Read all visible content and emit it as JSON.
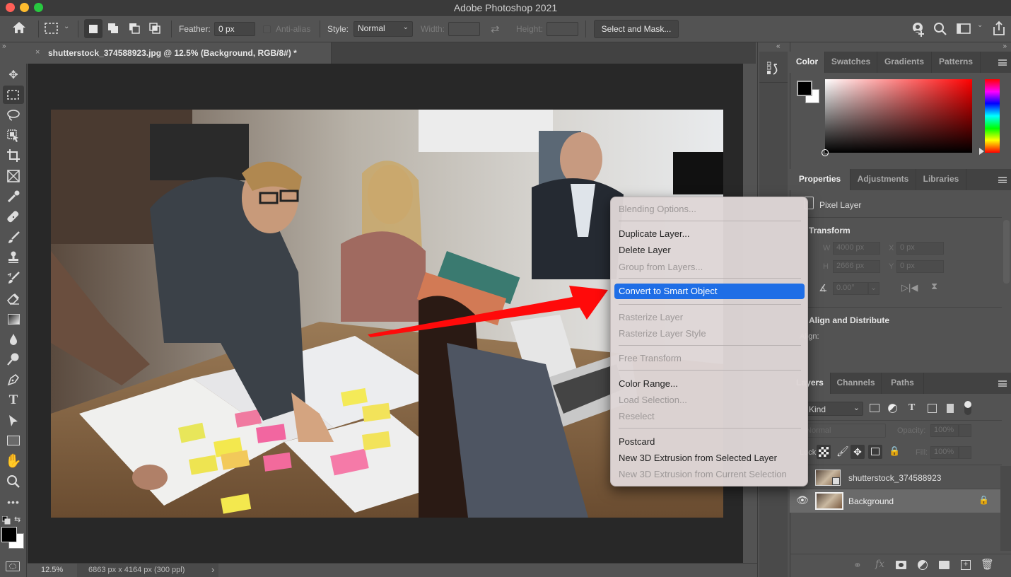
{
  "window": {
    "title": "Adobe Photoshop 2021",
    "traffic_lights": {
      "close": "#fe5f57",
      "minimize": "#febc2e",
      "zoom": "#28c840"
    }
  },
  "options_bar": {
    "home_icon": "home-icon",
    "marquee_icon": "rectangular-marquee-icon",
    "feather_label": "Feather:",
    "feather_value": "0 px",
    "anti_alias_label": "Anti-alias",
    "anti_alias_checked": false,
    "style_label": "Style:",
    "style_value": "Normal",
    "width_label": "Width:",
    "width_value": "",
    "height_label": "Height:",
    "height_value": "",
    "select_and_mask_label": "Select and Mask...",
    "right_icons": [
      "share-user-icon",
      "search-icon",
      "workspace-icon",
      "export-icon"
    ]
  },
  "document_tab": {
    "close_glyph": "×",
    "label": "shutterstock_374588923.jpg @ 12.5% (Background, RGB/8#) *"
  },
  "toolbar": {
    "tools": [
      "move",
      "rectangular-marquee",
      "lasso",
      "object-selection",
      "crop",
      "frame",
      "eyedropper",
      "spot-healing-brush",
      "brush",
      "clone-stamp",
      "history-brush",
      "eraser",
      "gradient",
      "blur",
      "dodge",
      "pen",
      "type",
      "path-selection",
      "rectangle",
      "hand",
      "zoom",
      "edit-toolbar"
    ],
    "active_tool": "rectangular-marquee",
    "foreground_color": "#000000",
    "background_color": "#ffffff"
  },
  "status_bar": {
    "zoom": "12.5%",
    "doc_info": "6863 px x 4164 px (300 ppl)",
    "arrow": "›"
  },
  "color_panel": {
    "tabs": [
      "Color",
      "Swatches",
      "Gradients",
      "Patterns"
    ],
    "active_tab": "Color",
    "hue_color": "#ff0000"
  },
  "properties_panel": {
    "tabs": [
      "Properties",
      "Adjustments",
      "Libraries"
    ],
    "active_tab": "Properties",
    "layer_type": "Pixel Layer",
    "transform_heading": "Transform",
    "w_label": "W",
    "w_value": "4000 px",
    "h_label": "H",
    "h_value": "2666 px",
    "x_label": "X",
    "x_value": "0 px",
    "y_label": "Y",
    "y_value": "0 px",
    "angle_value": "0.00°",
    "align_heading": "Align and Distribute",
    "align_label": "Align:"
  },
  "layers_panel": {
    "tabs": [
      "Layers",
      "Channels",
      "Paths"
    ],
    "active_tab": "Layers",
    "filter_kind": "Kind",
    "blend_mode": "Normal",
    "opacity_label": "Opacity:",
    "opacity_value": "100%",
    "lock_label": "Lock:",
    "fill_label": "Fill:",
    "fill_value": "100%",
    "layers": [
      {
        "name": "shutterstock_374588923",
        "visible": false,
        "smart_object": true,
        "locked": false,
        "selected": false
      },
      {
        "name": "Background",
        "visible": true,
        "smart_object": false,
        "locked": true,
        "selected": true
      }
    ],
    "footer_icons": [
      "link-icon",
      "fx-icon",
      "mask-icon",
      "adjustment-icon",
      "folder-icon",
      "new-layer-icon",
      "trash-icon"
    ]
  },
  "context_menu": {
    "items": [
      {
        "label": "Blending Options...",
        "enabled": false
      },
      {
        "separator": true
      },
      {
        "label": "Duplicate Layer...",
        "enabled": true
      },
      {
        "label": "Delete Layer",
        "enabled": true
      },
      {
        "label": "Group from Layers...",
        "enabled": false
      },
      {
        "separator": true
      },
      {
        "label": "Convert to Smart Object",
        "enabled": true,
        "highlighted": true
      },
      {
        "separator": true
      },
      {
        "label": "Rasterize Layer",
        "enabled": false
      },
      {
        "label": "Rasterize Layer Style",
        "enabled": false
      },
      {
        "separator": true
      },
      {
        "label": "Free Transform",
        "enabled": false
      },
      {
        "separator": true
      },
      {
        "label": "Color Range...",
        "enabled": true
      },
      {
        "label": "Load Selection...",
        "enabled": false
      },
      {
        "label": "Reselect",
        "enabled": false
      },
      {
        "separator": true
      },
      {
        "label": "Postcard",
        "enabled": true
      },
      {
        "label": "New 3D Extrusion from Selected Layer",
        "enabled": true
      },
      {
        "label": "New 3D Extrusion from Current Selection",
        "enabled": false
      }
    ]
  },
  "annotation": {
    "arrow_color": "#ff0a0a",
    "points_to": "Convert to Smart Object"
  }
}
